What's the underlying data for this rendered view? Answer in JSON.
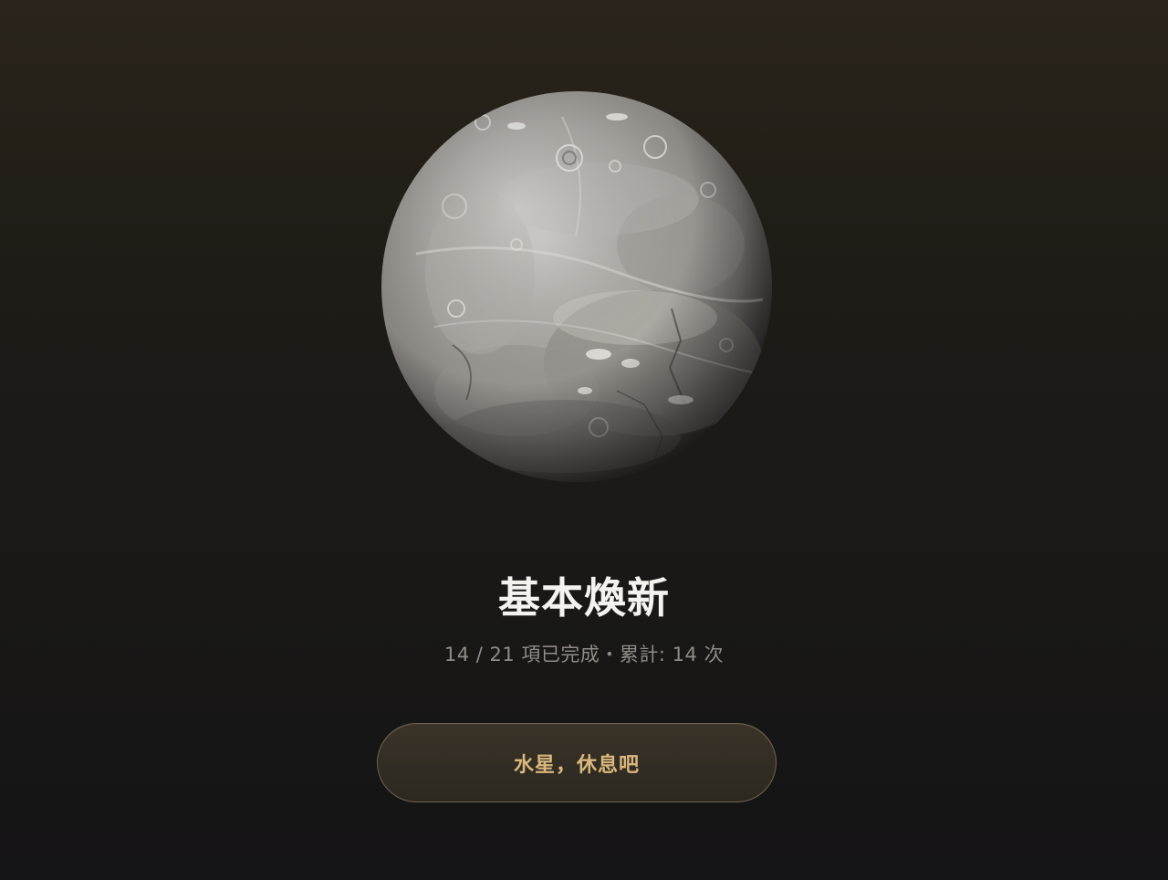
{
  "planet": {
    "icon": "mercury-planet-icon"
  },
  "habit": {
    "title": "基本煥新",
    "progress_text": "14 / 21 項已完成・累計: 14 次",
    "completed": 14,
    "total": 21,
    "total_count": 14
  },
  "action": {
    "button_label": "水星，休息吧"
  },
  "colors": {
    "button_text": "#d9b77d",
    "button_border": "#6f6350",
    "title": "#f4f2ee",
    "subtitle": "#8f8c88"
  }
}
